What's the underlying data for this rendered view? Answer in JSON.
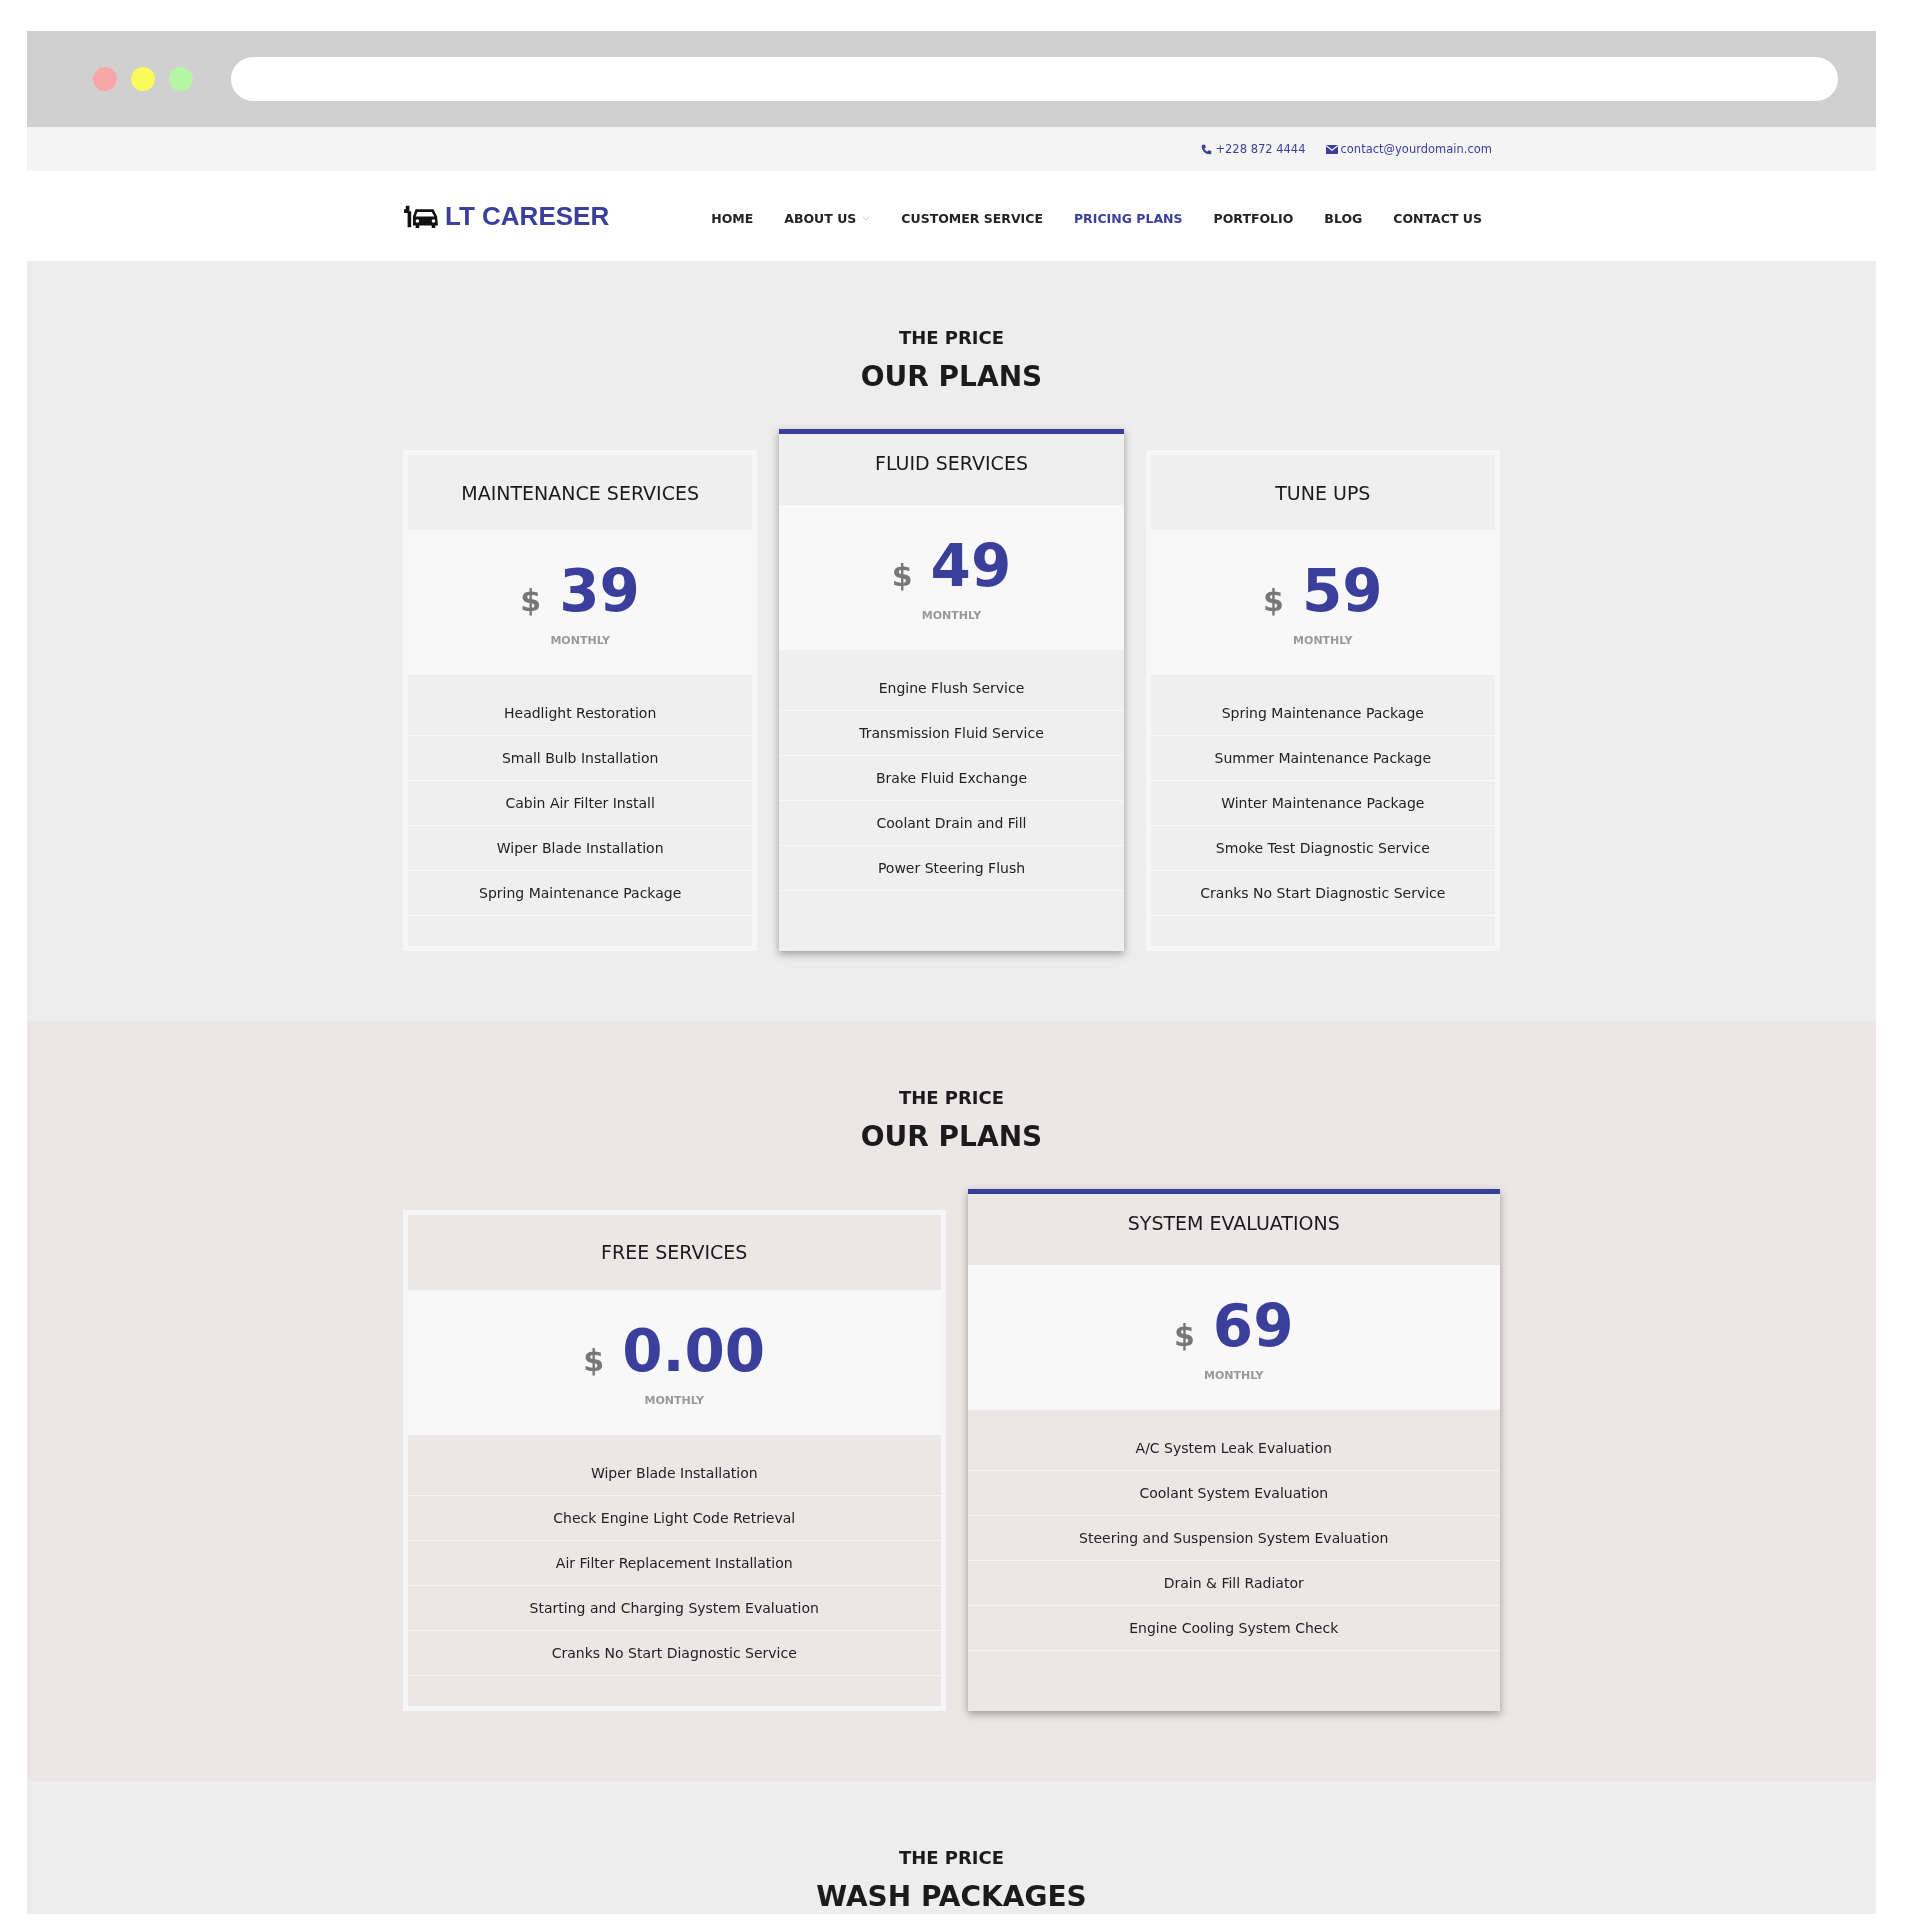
{
  "topbar": {
    "phone": "+228 872 4444",
    "email": "contact@yourdomain.com"
  },
  "logo": {
    "text": "LT CARESER"
  },
  "nav": [
    {
      "label": "HOME",
      "selected": false,
      "dropdown": false
    },
    {
      "label": "ABOUT US",
      "selected": false,
      "dropdown": true
    },
    {
      "label": "CUSTOMER SERVICE",
      "selected": false,
      "dropdown": false
    },
    {
      "label": "PRICING PLANS",
      "selected": true,
      "dropdown": false
    },
    {
      "label": "PORTFOLIO",
      "selected": false,
      "dropdown": false
    },
    {
      "label": "BLOG",
      "selected": false,
      "dropdown": false
    },
    {
      "label": "CONTACT US",
      "selected": false,
      "dropdown": false
    }
  ],
  "sections": [
    {
      "kicker": "THE PRICE",
      "title": "OUR PLANS",
      "plans": [
        {
          "name": "MAINTENANCE SERVICES",
          "currency": "$",
          "price": "39",
          "period": "MONTHLY",
          "featured": false,
          "features": [
            "Headlight Restoration",
            "Small Bulb Installation",
            "Cabin Air Filter Install",
            "Wiper Blade Installation",
            "Spring Maintenance Package"
          ]
        },
        {
          "name": "FLUID SERVICES",
          "currency": "$",
          "price": "49",
          "period": "MONTHLY",
          "featured": true,
          "features": [
            "Engine Flush Service",
            "Transmission Fluid Service",
            "Brake Fluid Exchange",
            "Coolant Drain and Fill",
            "Power Steering Flush"
          ]
        },
        {
          "name": "TUNE UPS",
          "currency": "$",
          "price": "59",
          "period": "MONTHLY",
          "featured": false,
          "features": [
            "Spring Maintenance Package",
            "Summer Maintenance Package",
            "Winter Maintenance Package",
            "Smoke Test Diagnostic Service",
            "Cranks No Start Diagnostic Service"
          ]
        }
      ]
    },
    {
      "kicker": "THE PRICE",
      "title": "OUR PLANS",
      "plans": [
        {
          "name": "FREE SERVICES",
          "currency": "$",
          "price": "0.00",
          "period": "MONTHLY",
          "featured": false,
          "features": [
            "Wiper Blade Installation",
            "Check Engine Light Code Retrieval",
            "Air Filter Replacement Installation",
            "Starting and Charging System Evaluation",
            "Cranks No Start Diagnostic Service"
          ]
        },
        {
          "name": "SYSTEM EVALUATIONS",
          "currency": "$",
          "price": "69",
          "period": "MONTHLY",
          "featured": true,
          "features": [
            "A/C System Leak Evaluation",
            "Coolant System Evaluation",
            "Steering and Suspension System Evaluation",
            "Drain & Fill Radiator",
            "Engine Cooling System Check"
          ]
        }
      ]
    },
    {
      "kicker": "THE PRICE",
      "title": "WASH PACKAGES"
    }
  ]
}
